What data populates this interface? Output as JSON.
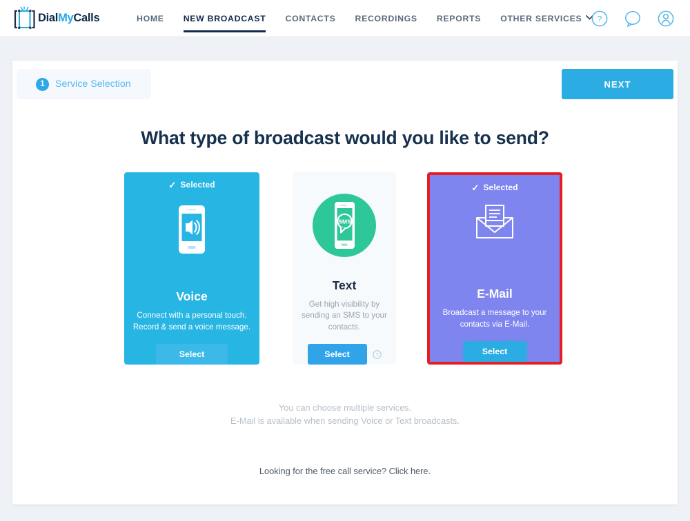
{
  "brand": {
    "logo_dial": "Dial",
    "logo_my": "My",
    "logo_calls": "Calls",
    "logo_icon": "phone-bracket-icon",
    "accent_blue": "#2bade3",
    "navy": "#14294b",
    "green": "#2ec79a",
    "purple": "#7f85ee",
    "highlight_red": "#e51d24"
  },
  "nav": {
    "links": [
      {
        "label": "HOME",
        "active": false
      },
      {
        "label": "NEW BROADCAST",
        "active": true
      },
      {
        "label": "CONTACTS",
        "active": false
      },
      {
        "label": "RECORDINGS",
        "active": false
      },
      {
        "label": "REPORTS",
        "active": false
      },
      {
        "label": "OTHER SERVICES",
        "active": false,
        "caret": "⌵"
      }
    ],
    "icons": [
      {
        "name": "help-circle-icon"
      },
      {
        "name": "chat-bubble-icon"
      },
      {
        "name": "user-account-icon"
      }
    ]
  },
  "step": {
    "number": "1",
    "label": "Service Selection"
  },
  "toolbar": {
    "next_label": "NEXT"
  },
  "main": {
    "heading": "What type of broadcast would you like to send?",
    "cards": [
      {
        "id": "voice",
        "title": "Voice",
        "description": "Connect with a personal touch. Record & send a voice message.",
        "selected_label": "Selected",
        "selected": true,
        "select_label": "Select",
        "icon": "phone-speaker-icon",
        "bg": "#27b6e3"
      },
      {
        "id": "text",
        "title": "Text",
        "description": "Get high visibility by sending an SMS to your contacts.",
        "selected_label": "",
        "selected": false,
        "select_label": "Select",
        "icon": "phone-sms-bubble-icon",
        "bg": "#f6fafc",
        "help_icon": "help-circle-small-icon"
      },
      {
        "id": "email",
        "title": "E-Mail",
        "description": "Broadcast a message to your contacts via E-Mail.",
        "selected_label": "Selected",
        "selected": true,
        "select_label": "Select",
        "icon": "open-envelope-letter-icon",
        "bg": "#7f85ee",
        "highlighted": true
      }
    ],
    "note_line1": "You can choose multiple services.",
    "note_line2": "E-Mail is available when sending Voice or Text broadcasts.",
    "free_call_text": "Looking for the free call service? Click here."
  }
}
